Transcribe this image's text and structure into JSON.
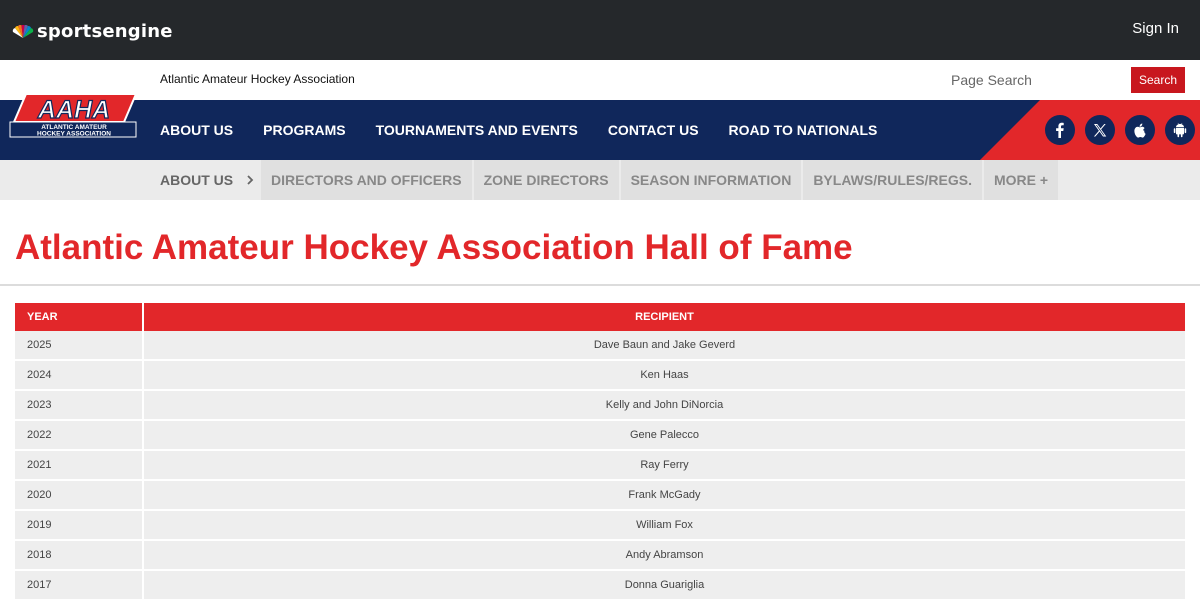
{
  "topbar": {
    "brand": "sportsengine",
    "sign_in": "Sign In"
  },
  "subbar": {
    "org_name": "Atlantic Amateur Hockey Association",
    "search_placeholder": "Page Search",
    "search_button": "Search"
  },
  "logo": {
    "letters": "AAHA",
    "line1": "ATLANTIC AMATEUR",
    "line2": "HOCKEY ASSOCIATION"
  },
  "main_nav": {
    "items": [
      "About Us",
      "Programs",
      "Tournaments and Events",
      "Contact Us",
      "Road to Nationals"
    ]
  },
  "social": {
    "icons": [
      "facebook-icon",
      "x-twitter-icon",
      "apple-icon",
      "android-icon"
    ]
  },
  "sub_nav": {
    "current": "About Us",
    "items": [
      "Directors and Officers",
      "Zone Directors",
      "Season Information",
      "Bylaws/Rules/Regs.",
      "More +"
    ]
  },
  "page": {
    "title": "Atlantic Amateur Hockey Association Hall of Fame"
  },
  "table": {
    "headers": {
      "year": "Year",
      "recipient": "Recipient"
    },
    "rows": [
      {
        "year": "2025",
        "recipient": "Dave Baun and Jake Geverd"
      },
      {
        "year": "2024",
        "recipient": "Ken Haas"
      },
      {
        "year": "2023",
        "recipient": "Kelly and John DiNorcia"
      },
      {
        "year": "2022",
        "recipient": "Gene Palecco"
      },
      {
        "year": "2021",
        "recipient": "Ray Ferry"
      },
      {
        "year": "2020",
        "recipient": "Frank McGady"
      },
      {
        "year": "2019",
        "recipient": "William Fox"
      },
      {
        "year": "2018",
        "recipient": "Andy Abramson"
      },
      {
        "year": "2017",
        "recipient": "Donna Guariglia"
      }
    ]
  },
  "colors": {
    "topbar": "#25282b",
    "navy": "#10275b",
    "red": "#e2272a",
    "search_red": "#c8171e",
    "row_bg": "#eeeeee"
  }
}
